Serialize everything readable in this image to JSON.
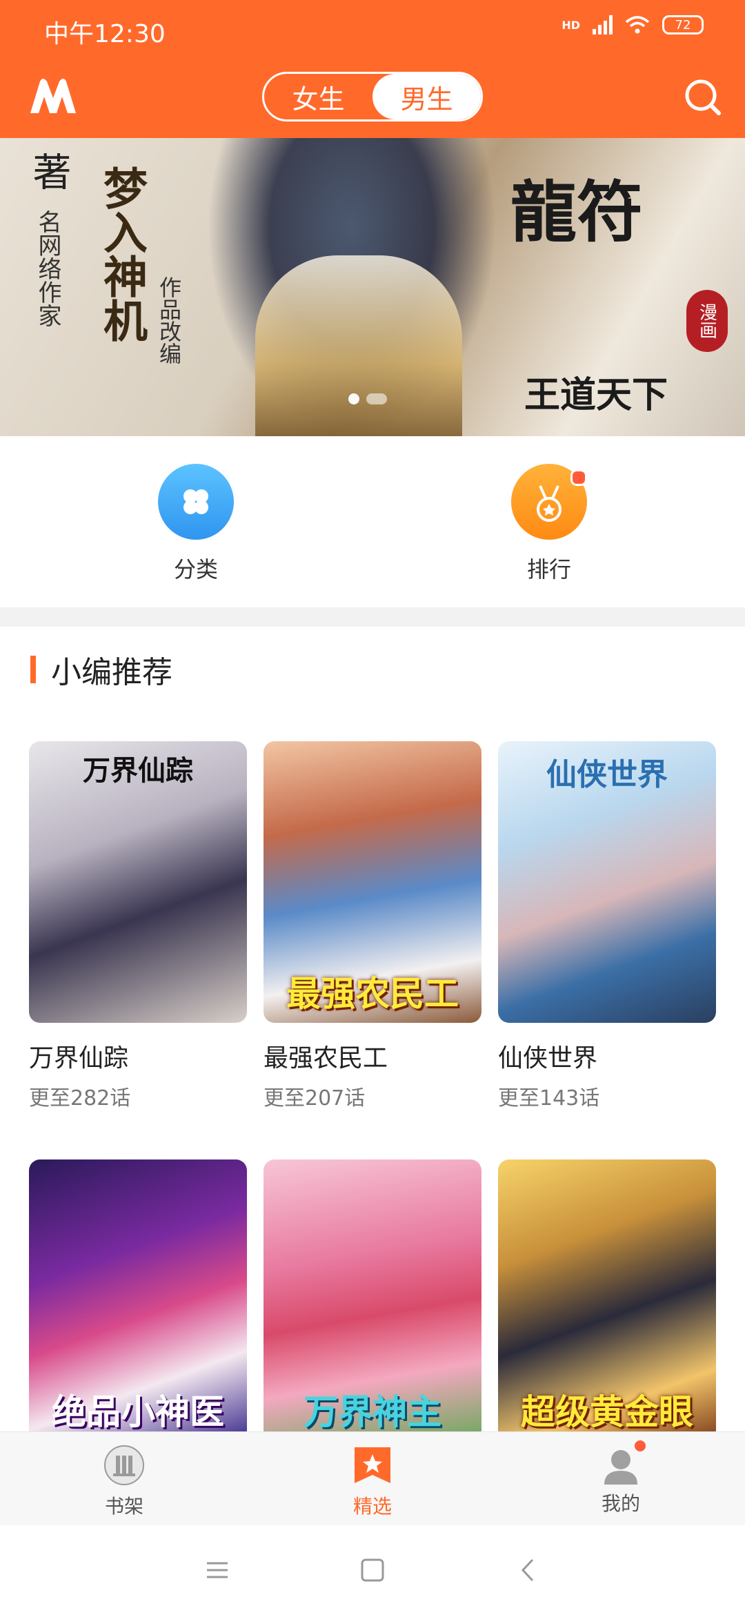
{
  "status_bar": {
    "time": "中午12:30",
    "network": "HD",
    "battery": "72"
  },
  "header": {
    "tabs": [
      {
        "label": "女生",
        "active": false
      },
      {
        "label": "男生",
        "active": true
      }
    ],
    "logo_icon": "m-logo-icon",
    "search_icon": "search-icon",
    "accent_color": "#ff6a2b"
  },
  "banner": {
    "left_text_big": "著",
    "left_text_sub": "名网络作家",
    "calligraphy_title": "梦入神机",
    "calligraphy_sub": "作品改编",
    "right_title": "龍符",
    "right_sub": "王道天下",
    "seal": "漫画",
    "slide_count": 2,
    "active_slide": 1
  },
  "quick_entries": [
    {
      "label": "分类",
      "icon": "clover-icon",
      "color": "#3aa8f5",
      "badge": false
    },
    {
      "label": "排行",
      "icon": "medal-icon",
      "color": "#ff9a1a",
      "badge": true
    }
  ],
  "section": {
    "title": "小编推荐"
  },
  "comics": [
    {
      "name": "万界仙踪",
      "update": "更至282话",
      "cover_text": "万界仙踪"
    },
    {
      "name": "最强农民工",
      "update": "更至207话",
      "cover_text": "最强农民工"
    },
    {
      "name": "仙侠世界",
      "update": "更至143话",
      "cover_text": "仙侠世界"
    },
    {
      "name": "",
      "update": "",
      "cover_text": "绝品小神医"
    },
    {
      "name": "",
      "update": "",
      "cover_text": "万界神主"
    },
    {
      "name": "",
      "update": "",
      "cover_text": "超级黄金眼"
    }
  ],
  "bottom_nav": [
    {
      "label": "书架",
      "icon": "bookshelf-icon",
      "active": false,
      "badge": false
    },
    {
      "label": "精选",
      "icon": "featured-icon",
      "active": true,
      "badge": false
    },
    {
      "label": "我的",
      "icon": "profile-icon",
      "active": false,
      "badge": true
    }
  ],
  "system_nav": {
    "menu_icon": "menu-icon",
    "home_icon": "home-icon",
    "back_icon": "back-icon"
  }
}
